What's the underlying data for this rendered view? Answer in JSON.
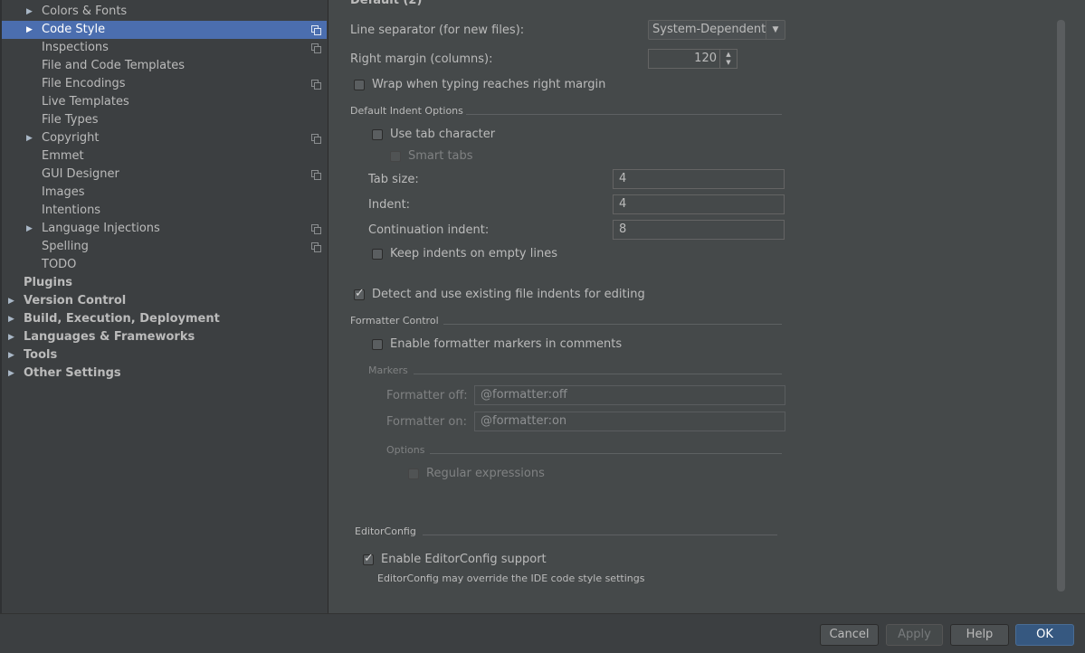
{
  "sidebar": {
    "items": [
      {
        "label": "Colors & Fonts",
        "expandable": true,
        "copy_icon": false
      },
      {
        "label": "Code Style",
        "expandable": true,
        "copy_icon": true,
        "selected": true
      },
      {
        "label": "Inspections",
        "expandable": false,
        "copy_icon": true
      },
      {
        "label": "File and Code Templates",
        "expandable": false,
        "copy_icon": false
      },
      {
        "label": "File Encodings",
        "expandable": false,
        "copy_icon": true
      },
      {
        "label": "Live Templates",
        "expandable": false,
        "copy_icon": false
      },
      {
        "label": "File Types",
        "expandable": false,
        "copy_icon": false
      },
      {
        "label": "Copyright",
        "expandable": true,
        "copy_icon": true
      },
      {
        "label": "Emmet",
        "expandable": false,
        "copy_icon": false
      },
      {
        "label": "GUI Designer",
        "expandable": false,
        "copy_icon": true
      },
      {
        "label": "Images",
        "expandable": false,
        "copy_icon": false
      },
      {
        "label": "Intentions",
        "expandable": false,
        "copy_icon": false
      },
      {
        "label": "Language Injections",
        "expandable": true,
        "copy_icon": true
      },
      {
        "label": "Spelling",
        "expandable": false,
        "copy_icon": true
      },
      {
        "label": "TODO",
        "expandable": false,
        "copy_icon": false
      }
    ],
    "top_items": [
      {
        "label": "Plugins",
        "expandable": false
      },
      {
        "label": "Version Control",
        "expandable": true
      },
      {
        "label": "Build, Execution, Deployment",
        "expandable": true
      },
      {
        "label": "Languages & Frameworks",
        "expandable": true
      },
      {
        "label": "Tools",
        "expandable": true
      },
      {
        "label": "Other Settings",
        "expandable": true
      }
    ]
  },
  "main": {
    "cut_header": "Default (2)",
    "line_separator_label": "Line separator (for new files):",
    "line_separator_value": "System-Dependent",
    "right_margin_label": "Right margin (columns):",
    "right_margin_value": "120",
    "wrap_label": "Wrap when typing reaches right margin",
    "wrap_checked": false,
    "default_indent": {
      "section_title": "Default Indent Options",
      "use_tab_label": "Use tab character",
      "smart_tabs_label": "Smart tabs",
      "tab_size_label": "Tab size:",
      "tab_size_value": "4",
      "indent_label": "Indent:",
      "indent_value": "4",
      "continuation_label": "Continuation indent:",
      "continuation_value": "8",
      "keep_indents_label": "Keep indents on empty lines"
    },
    "detect_label": "Detect and use existing file indents for editing",
    "detect_checked": true,
    "formatter": {
      "section_title": "Formatter Control",
      "enable_markers_label": "Enable formatter markers in comments",
      "markers_title": "Markers",
      "off_label": "Formatter off:",
      "off_value": "@formatter:off",
      "on_label": "Formatter on:",
      "on_value": "@formatter:on",
      "options_title": "Options",
      "regex_label": "Regular expressions"
    },
    "editorconfig": {
      "section_title": "EditorConfig",
      "enable_label": "Enable EditorConfig support",
      "enable_checked": true,
      "note": "EditorConfig may override the IDE code style settings"
    }
  },
  "footer": {
    "cancel": "Cancel",
    "apply": "Apply",
    "help": "Help",
    "ok": "OK"
  },
  "colors": {
    "selection": "#4b6eaf",
    "panel_bg": "#45494a",
    "sidebar_bg": "#3c3f41",
    "primary_button": "#365880"
  }
}
